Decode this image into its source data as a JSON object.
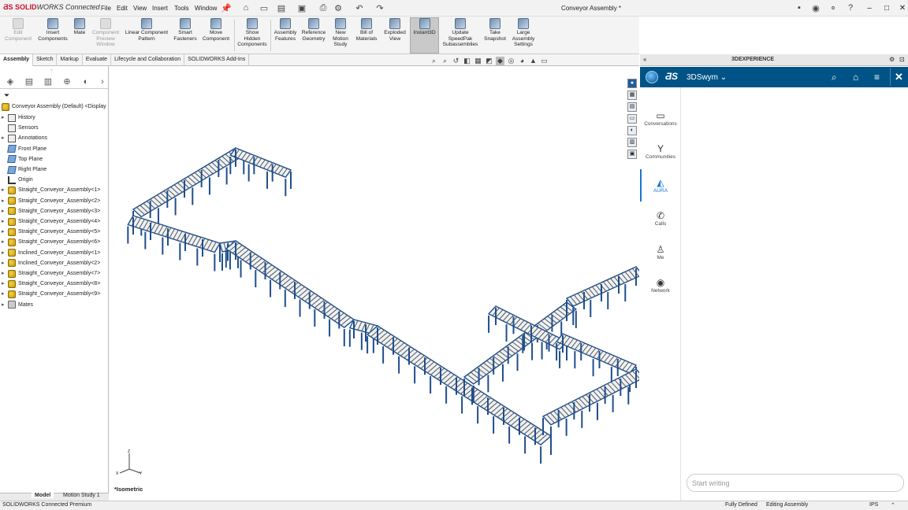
{
  "title_bar": {
    "app_name_prefix": "SOLID",
    "app_name_suffix": "WORKS Connected",
    "document_title": "Conveyor Assembly *",
    "menus": [
      "File",
      "Edit",
      "View",
      "Insert",
      "Tools",
      "Window"
    ]
  },
  "command_manager": {
    "commands": [
      {
        "label": "Edit\nComponent",
        "enabled": false
      },
      {
        "label": "Insert\nComponents",
        "enabled": true
      },
      {
        "label": "Mate",
        "enabled": true
      },
      {
        "label": "Component\nPreview\nWindow",
        "enabled": false
      },
      {
        "label": "Linear Component\nPattern",
        "enabled": true
      },
      {
        "label": "Smart\nFasteners",
        "enabled": true
      },
      {
        "label": "Move\nComponent",
        "enabled": true
      },
      {
        "label": "Show\nHidden\nComponents",
        "enabled": true
      },
      {
        "label": "Assembly\nFeatures",
        "enabled": true
      },
      {
        "label": "Reference\nGeometry",
        "enabled": true
      },
      {
        "label": "New\nMotion\nStudy",
        "enabled": true
      },
      {
        "label": "Bill of\nMaterials",
        "enabled": true
      },
      {
        "label": "Exploded\nView",
        "enabled": true
      },
      {
        "label": "Instant3D",
        "enabled": true,
        "active": true
      },
      {
        "label": "Update\nSpeedPak\nSubassemblies",
        "enabled": true
      },
      {
        "label": "Take\nSnapshot",
        "enabled": true
      },
      {
        "label": "Large\nAssembly\nSettings",
        "enabled": true
      }
    ]
  },
  "tabs": [
    "Assembly",
    "Sketch",
    "Markup",
    "Evaluate",
    "Lifecycle and Collaboration",
    "SOLIDWORKS Add-Ins"
  ],
  "feature_tree": {
    "root": "Conveyor Assembly (Default) <Display",
    "items": [
      {
        "label": "History",
        "icon": "folder-icon",
        "expandable": true
      },
      {
        "label": "Sensors",
        "icon": "sensor-icon",
        "expandable": false
      },
      {
        "label": "Annotations",
        "icon": "annotation-icon",
        "expandable": true
      },
      {
        "label": "Front Plane",
        "icon": "plane-icon",
        "expandable": false
      },
      {
        "label": "Top Plane",
        "icon": "plane-icon",
        "expandable": false
      },
      {
        "label": "Right Plane",
        "icon": "plane-icon",
        "expandable": false
      },
      {
        "label": "Origin",
        "icon": "origin-icon",
        "expandable": false
      },
      {
        "label": "Straight_Conveyor_Assembly<1>",
        "icon": "component-icon",
        "expandable": true
      },
      {
        "label": "Straight_Conveyor_Assembly<2>",
        "icon": "component-icon",
        "expandable": true
      },
      {
        "label": "Straight_Conveyor_Assembly<3>",
        "icon": "component-icon",
        "expandable": true
      },
      {
        "label": "Straight_Conveyor_Assembly<4>",
        "icon": "component-icon",
        "expandable": true
      },
      {
        "label": "Straight_Conveyor_Assembly<5>",
        "icon": "component-icon",
        "expandable": true
      },
      {
        "label": "Straight_Conveyor_Assembly<6>",
        "icon": "component-icon",
        "expandable": true
      },
      {
        "label": "Inclined_Conveyor_Assembly<1>",
        "icon": "component-icon",
        "expandable": true
      },
      {
        "label": "Inclined_Conveyor_Assembly<2>",
        "icon": "component-icon",
        "expandable": true
      },
      {
        "label": "Straight_Conveyor_Assembly<7>",
        "icon": "component-icon",
        "expandable": true
      },
      {
        "label": "Straight_Conveyor_Assembly<8>",
        "icon": "component-icon",
        "expandable": true
      },
      {
        "label": "Straight_Conveyor_Assembly<9>",
        "icon": "component-icon",
        "expandable": true
      },
      {
        "label": "Mates",
        "icon": "mates-icon",
        "expandable": true
      }
    ]
  },
  "viewport": {
    "view_orientation": "*Isometric",
    "model_color": "#1f4e8c"
  },
  "bottom_tabs": {
    "model": "Model",
    "motion": "Motion Study 1"
  },
  "experience_panel": {
    "header": "3DEXPERIENCE",
    "app_name": "3DSwym",
    "nav": [
      {
        "label": "Conversations",
        "icon": "chat-icon",
        "selected": false
      },
      {
        "label": "Communities",
        "icon": "communities-icon",
        "selected": false
      },
      {
        "label": "AURA",
        "icon": "aura-icon",
        "selected": true
      },
      {
        "label": "Calls",
        "icon": "phone-icon",
        "selected": false
      },
      {
        "label": "Me",
        "icon": "person-icon",
        "selected": false
      },
      {
        "label": "Network",
        "icon": "network-icon",
        "selected": false
      }
    ],
    "input_placeholder": "Start writing",
    "accent": "#005386"
  },
  "status_bar": {
    "product": "SOLIDWORKS Connected Premium",
    "state": "Fully Defined",
    "mode": "Editing Assembly",
    "units": "IPS"
  }
}
